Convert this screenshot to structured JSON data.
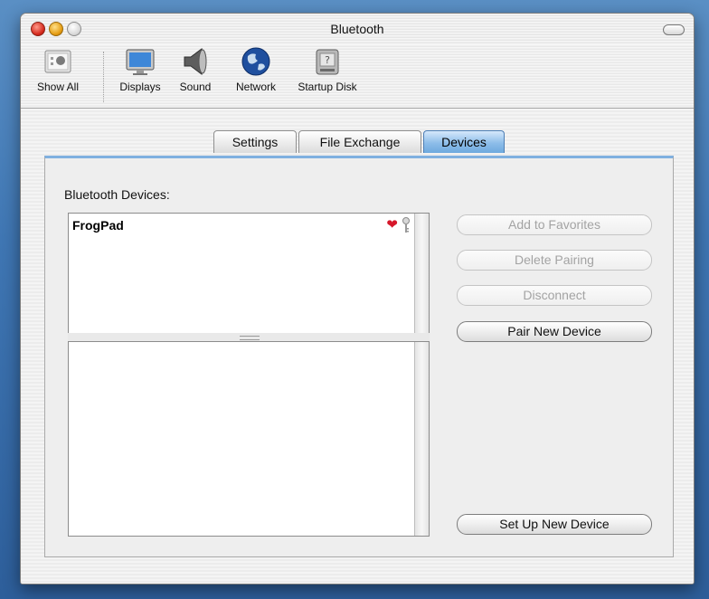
{
  "window": {
    "title": "Bluetooth"
  },
  "toolbar": {
    "items": [
      {
        "label": "Show All",
        "icon": "show-all-icon"
      },
      {
        "label": "Displays",
        "icon": "displays-icon"
      },
      {
        "label": "Sound",
        "icon": "sound-icon"
      },
      {
        "label": "Network",
        "icon": "network-icon"
      },
      {
        "label": "Startup Disk",
        "icon": "startup-disk-icon"
      }
    ]
  },
  "tabs": [
    {
      "label": "Settings",
      "active": false
    },
    {
      "label": "File Exchange",
      "active": false
    },
    {
      "label": "Devices",
      "active": true
    }
  ],
  "devices": {
    "label": "Bluetooth Devices:",
    "list": [
      {
        "name": "FrogPad",
        "favorite": true,
        "paired": true
      }
    ]
  },
  "buttons": {
    "add_favorites": "Add to Favorites",
    "delete_pairing": "Delete Pairing",
    "disconnect": "Disconnect",
    "pair_new": "Pair New Device",
    "set_up_new": "Set Up New Device"
  },
  "colors": {
    "accent": "#6ea9de",
    "favorite": "#d6172a"
  }
}
